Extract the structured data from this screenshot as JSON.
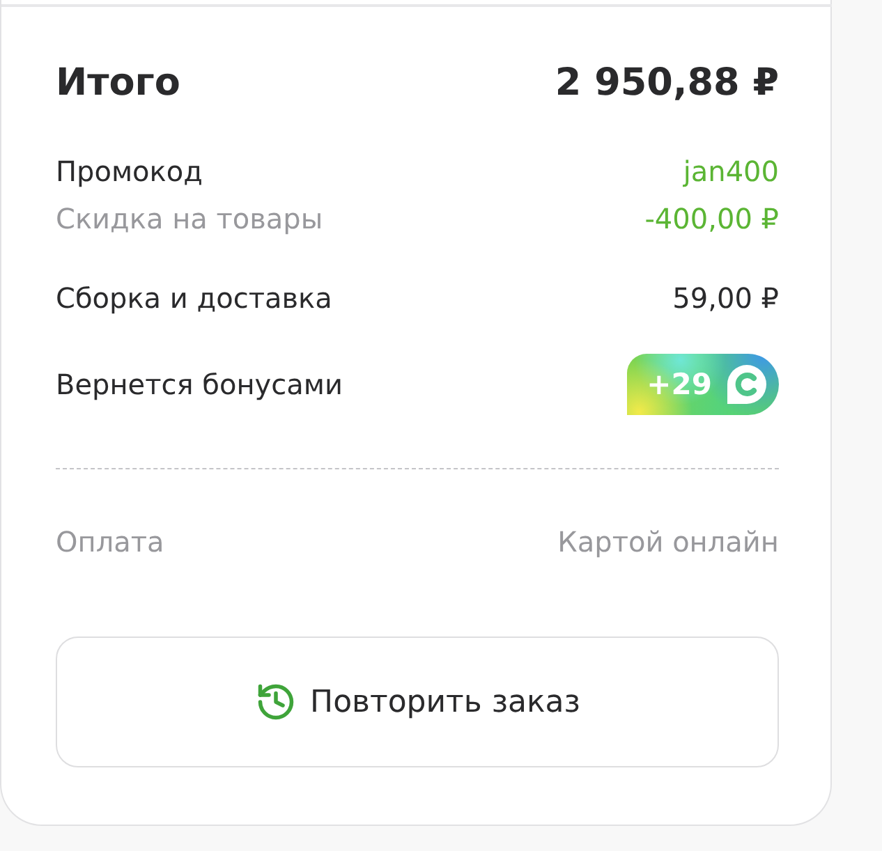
{
  "summary_rows": [
    {
      "kind": "total",
      "label": "Итого",
      "value": "2 950,88 ₽"
    },
    {
      "kind": "promo",
      "label": "Промокод",
      "value": "jan400"
    },
    {
      "kind": "discount",
      "label": "Скидка на товары",
      "value": "-400,00 ₽"
    },
    {
      "kind": "line",
      "label": "Сборка и доставка",
      "value": "59,00 ₽"
    },
    {
      "kind": "bonus",
      "label": "Вернется бонусами",
      "value": "+29"
    }
  ],
  "payment": {
    "label": "Оплата",
    "value": "Картой онлайн"
  },
  "repeat_button": {
    "label": "Повторить заказ"
  }
}
